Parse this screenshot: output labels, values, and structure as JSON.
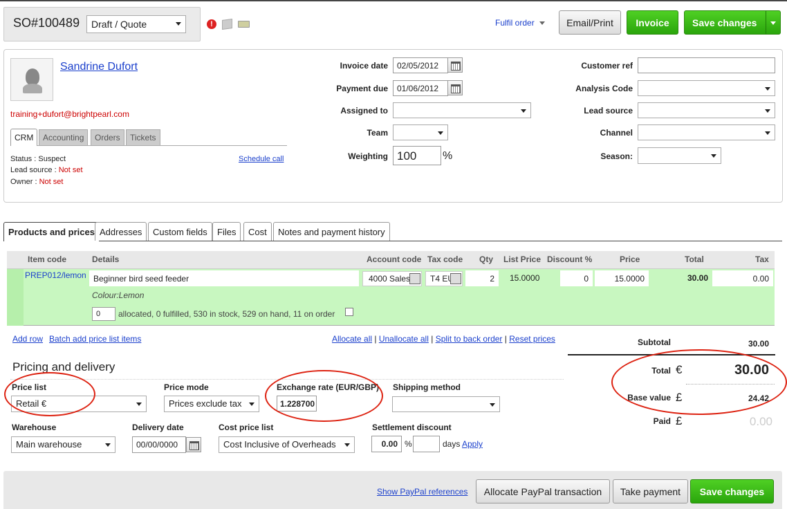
{
  "header": {
    "order_no": "SO#100489",
    "status": "Draft / Quote",
    "fulfil": "Fulfil order",
    "email_print": "Email/Print",
    "invoice": "Invoice",
    "save": "Save changes"
  },
  "customer": {
    "name": "Sandrine Dufort",
    "email": "training+dufort@brightpearl.com",
    "tabs": [
      "CRM",
      "Accounting",
      "Orders",
      "Tickets"
    ],
    "status_label": "Status : ",
    "status_val": "Suspect",
    "lead_label": "Lead source : ",
    "lead_val": "Not set",
    "owner_label": "Owner : ",
    "owner_val": "Not set",
    "schedule": "Schedule call"
  },
  "fields": {
    "invoice_date_label": "Invoice date",
    "invoice_date": "02/05/2012",
    "payment_due_label": "Payment due",
    "payment_due": "01/06/2012",
    "assigned_label": "Assigned to",
    "team_label": "Team",
    "weighting_label": "Weighting",
    "weighting": "100",
    "percent": "%",
    "customer_ref_label": "Customer ref",
    "analysis_label": "Analysis Code",
    "lead_source_label": "Lead source",
    "channel_label": "Channel",
    "season_label": "Season:"
  },
  "tabs": [
    "Products and prices",
    "Addresses",
    "Custom fields",
    "Files",
    "Cost",
    "Notes and payment history"
  ],
  "table": {
    "headers": {
      "item_code": "Item code",
      "details": "Details",
      "account": "Account code",
      "tax_code": "Tax code",
      "qty": "Qty",
      "list_price": "List Price",
      "discount": "Discount %",
      "price": "Price",
      "total": "Total",
      "tax": "Tax"
    },
    "row": {
      "item_code": "PREP012/lemon",
      "details": "Beginner bird seed feeder",
      "account": "4000 Sales",
      "tax_code": "T4 EU",
      "qty": "2",
      "list_price": "15.0000",
      "discount": "0",
      "price": "15.0000",
      "total": "30.00",
      "tax": "0.00",
      "option": "Colour:Lemon",
      "alloc_qty": "0",
      "stock_text": "allocated, 0 fulfilled, 530 in stock, 529 on hand, 11 on order"
    }
  },
  "actions": {
    "add_row": "Add row",
    "batch": "Batch add price list items",
    "allocate_all": "Allocate all",
    "unallocate_all": "Unallocate all",
    "split": "Split to back order",
    "reset": "Reset prices",
    "sep": "|"
  },
  "pricing": {
    "title": "Pricing and delivery",
    "price_list_label": "Price list",
    "price_list": "Retail €",
    "price_mode_label": "Price mode",
    "price_mode": "Prices exclude tax",
    "exchange_label": "Exchange rate (EUR/GBP)",
    "exchange": "1.228700",
    "shipping_label": "Shipping method",
    "warehouse_label": "Warehouse",
    "warehouse": "Main warehouse",
    "delivery_label": "Delivery date",
    "delivery": "00/00/0000",
    "cost_list_label": "Cost price list",
    "cost_list": "Cost Inclusive of Overheads",
    "settlement_label": "Settlement discount",
    "settlement": "0.00",
    "days": "days",
    "apply": "Apply"
  },
  "totals": {
    "subtotal_label": "Subtotal",
    "subtotal": "30.00",
    "total_label": "Total",
    "total_cur": "€",
    "total": "30.00",
    "base_label": "Base value",
    "base_cur": "£",
    "base": "24.42",
    "paid_label": "Paid",
    "paid_cur": "£",
    "paid": "0.00"
  },
  "footer": {
    "paypal_refs": "Show PayPal references",
    "allocate_paypal": "Allocate PayPal transaction",
    "take_payment": "Take payment",
    "save": "Save changes"
  },
  "colors": {
    "green": "#2aa50c",
    "line_green": "#c8f7c0",
    "annot_red": "#d21111",
    "link": "#1a3fcc"
  }
}
